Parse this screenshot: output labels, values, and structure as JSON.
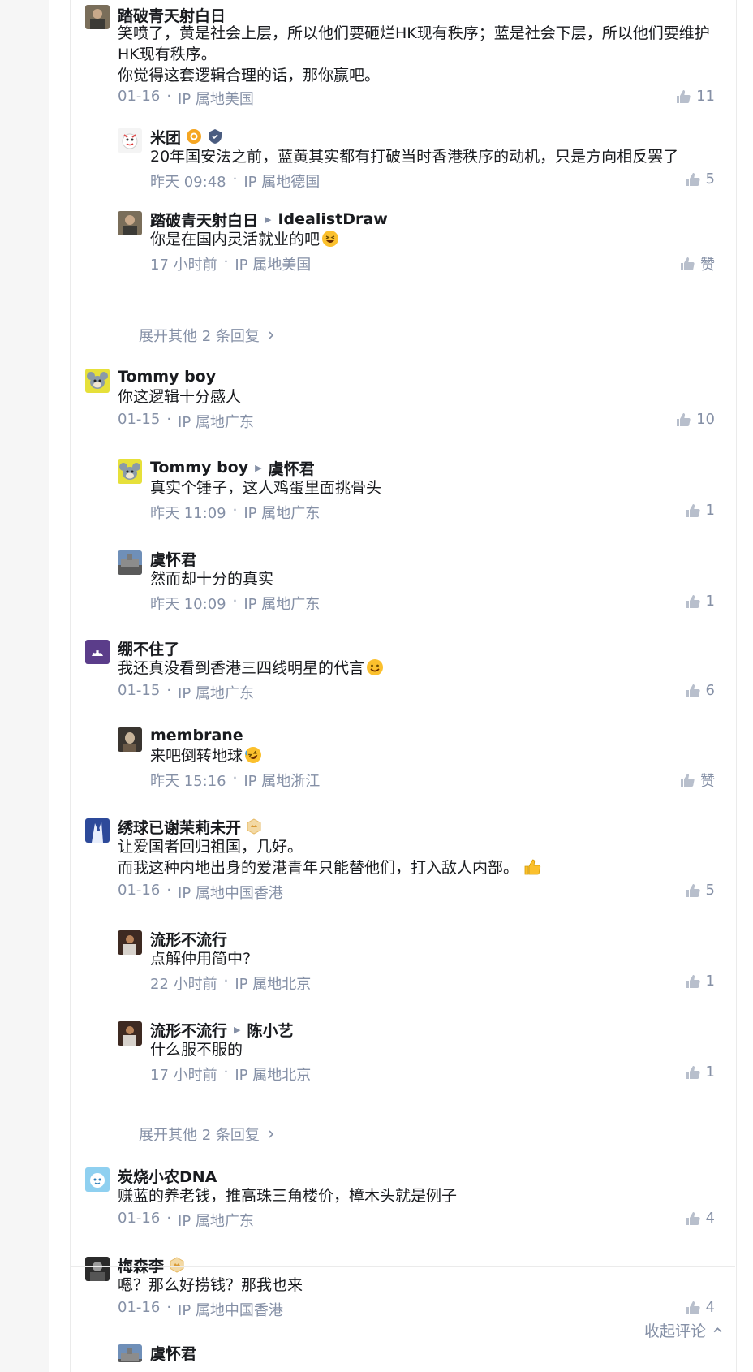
{
  "comments": [
    {
      "name": "踏破青天射白日",
      "lines": [
        "笑喷了，黄是社会上层，所以他们要砸烂HK现有秩序；蓝是社会下层，所以他们要维护",
        "HK现有秩序。",
        "你觉得这套逻辑合理的话，那你赢吧。"
      ],
      "date": "01-16",
      "sep": "·",
      "ip": "IP 属地美国",
      "likes": "11"
    },
    {
      "name": "米团",
      "lines": [
        "20年国安法之前，蓝黄其实都有打破当时香港秩序的动机，只是方向相反罢了"
      ],
      "date": "昨天 09:48",
      "sep": "·",
      "ip": "IP 属地德国",
      "likes": "5"
    },
    {
      "name": "踏破青天射白日",
      "reply_to": "IdealistDraw",
      "lines": [
        "你是在国内灵活就业的吧"
      ],
      "date": "17 小时前",
      "sep": "·",
      "ip": "IP 属地美国",
      "likes": "赞"
    },
    {
      "name": "Tommy boy",
      "lines": [
        "你这逻辑十分感人"
      ],
      "date": "01-15",
      "sep": "·",
      "ip": "IP 属地广东",
      "likes": "10"
    },
    {
      "name": "Tommy boy",
      "reply_to": "虞怀君",
      "lines": [
        "真实个锤子，这人鸡蛋里面挑骨头"
      ],
      "date": "昨天 11:09",
      "sep": "·",
      "ip": "IP 属地广东",
      "likes": "1"
    },
    {
      "name": "虞怀君",
      "lines": [
        "然而却十分的真实"
      ],
      "date": "昨天 10:09",
      "sep": "·",
      "ip": "IP 属地广东",
      "likes": "1"
    },
    {
      "name": "绷不住了",
      "lines": [
        "我还真没看到香港三四线明星的代言"
      ],
      "date": "01-15",
      "sep": "·",
      "ip": "IP 属地广东",
      "likes": "6"
    },
    {
      "name": "membrane",
      "lines": [
        "来吧倒转地球"
      ],
      "date": "昨天 15:16",
      "sep": "·",
      "ip": "IP 属地浙江",
      "likes": "赞"
    },
    {
      "name": "绣球已谢茉莉未开",
      "lines": [
        "让爱国者回归祖国，几好。",
        "而我这种内地出身的爱港青年只能替他们，打入敌人内部。"
      ],
      "date": "01-16",
      "sep": "·",
      "ip": "IP 属地中国香港",
      "likes": "5"
    },
    {
      "name": "流形不流行",
      "lines": [
        "点解仲用简中?"
      ],
      "date": "22 小时前",
      "sep": "·",
      "ip": "IP 属地北京",
      "likes": "1"
    },
    {
      "name": "流形不流行",
      "reply_to": "陈小艺",
      "lines": [
        "什么服不服的"
      ],
      "date": "17 小时前",
      "sep": "·",
      "ip": "IP 属地北京",
      "likes": "1"
    },
    {
      "name": "炭烧小农DNA",
      "lines": [
        "赚蓝的养老钱，推高珠三角楼价，樟木头就是例子"
      ],
      "date": "01-16",
      "sep": "·",
      "ip": "IP 属地广东",
      "likes": "4"
    },
    {
      "name": "梅森李",
      "lines": [
        "嗯？那么好捞钱？那我也来"
      ],
      "date": "01-16",
      "sep": "·",
      "ip": "IP 属地中国香港",
      "likes": "4"
    },
    {
      "name": "虞怀君"
    }
  ],
  "expand_label": "展开其他 2 条回复",
  "collapse_label": "收起评论",
  "colors": {
    "meta": "#8590a6",
    "text": "#191b1f",
    "badge_gold": "#f5a623",
    "badge_blue": "#4a5c80"
  },
  "icons": [
    "thumbs-up-icon",
    "chevron-right-icon",
    "chevron-up-icon",
    "triangle-right-icon",
    "emoji-laugh-icon",
    "emoji-smile-icon",
    "emoji-rofl-icon",
    "emoji-thumbs-up-icon",
    "gold-badge-icon",
    "shield-badge-icon",
    "level-badge-icon"
  ]
}
